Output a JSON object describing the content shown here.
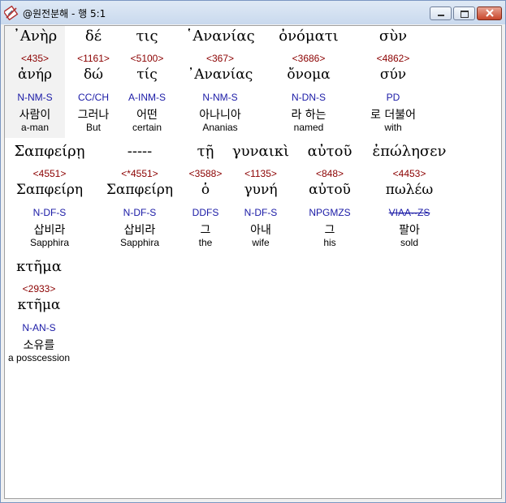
{
  "window": {
    "title": "@원전분해 - 행 5:1",
    "app_icon": "book-pen-icon",
    "controls": [
      "minimize-icon",
      "maximize-icon",
      "close-icon"
    ]
  },
  "rows": [
    [
      {
        "greek": "᾿Ανὴρ",
        "strong": "<435>",
        "lemma": "ἀνήρ",
        "parse": "N-NM-S",
        "korean": "사람이",
        "english": "a-man",
        "selected": true
      },
      {
        "greek": "δέ",
        "strong": "<1161>",
        "lemma": "δώ",
        "parse": "CC/CH",
        "korean": "그러나",
        "english": "But"
      },
      {
        "greek": "τις",
        "strong": "<5100>",
        "lemma": "τίς",
        "parse": "A-INM-S",
        "korean": "어떤",
        "english": "certain"
      },
      {
        "greek": "῾Ανανίας",
        "strong": "<367>",
        "lemma": "᾿Ανανίας",
        "parse": "N-NM-S",
        "korean": "아나니아",
        "english": "Ananias"
      },
      {
        "greek": "ὀνόματι",
        "strong": "<3686>",
        "lemma": "ὄνομα",
        "parse": "N-DN-S",
        "korean": "라 하는",
        "english": "named"
      },
      {
        "greek": "σὺν",
        "strong": "<4862>",
        "lemma": "σύν",
        "parse": "PD",
        "korean": "로 더불어",
        "english": "with"
      }
    ],
    [
      {
        "greek": "Σαπφείρῃ",
        "strong": "<4551>",
        "lemma": "Σαπφείρη",
        "parse": "N-DF-S",
        "korean": "삽비라",
        "english": "Sapphira"
      },
      {
        "greek": "-----",
        "strong": "<*4551>",
        "lemma": "Σαπφείρη",
        "parse": "N-DF-S",
        "korean": "삽비라",
        "english": "Sapphira"
      },
      {
        "greek": "τῇ",
        "strong": "<3588>",
        "lemma": "ὁ",
        "parse": "DDFS",
        "korean": "그",
        "english": "the"
      },
      {
        "greek": "γυναικὶ",
        "strong": "<1135>",
        "lemma": "γυνή",
        "parse": "N-DF-S",
        "korean": "아내",
        "english": "wife"
      },
      {
        "greek": "αὐτοῦ",
        "strong": "<848>",
        "lemma": "αὐτοῦ",
        "parse": "NPGMZS",
        "korean": "그",
        "english": "his"
      },
      {
        "greek": "ἐπώλησεν",
        "strong": "<4453>",
        "lemma": "πωλέω",
        "parse": "VIAA--ZS",
        "korean": "팔아",
        "english": "sold",
        "parse_strike": true
      }
    ],
    [
      {
        "greek": "κτῆμα",
        "strong": "<2933>",
        "lemma": "κτῆμα",
        "parse": "N-AN-S",
        "korean": "소유를",
        "english": "a posscession"
      }
    ]
  ]
}
